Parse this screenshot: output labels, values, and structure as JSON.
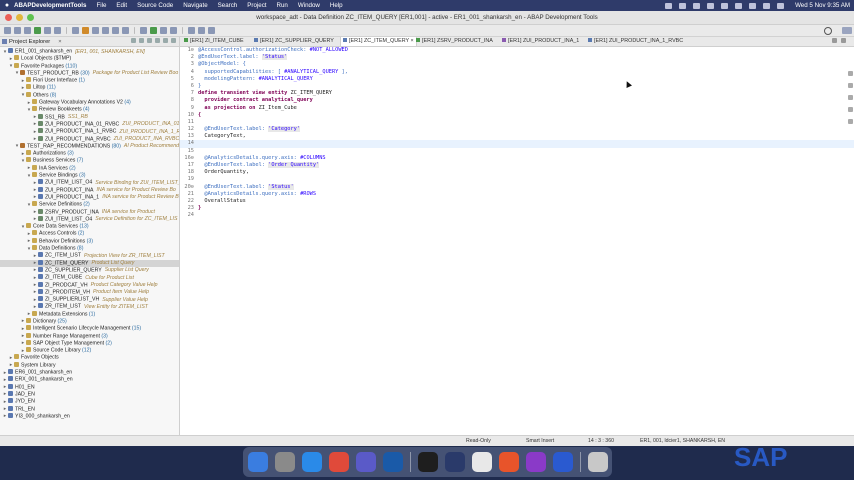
{
  "menubar": {
    "app": "ABAPDevelopmentTools",
    "items": [
      "File",
      "Edit",
      "Source Code",
      "Navigate",
      "Search",
      "Project",
      "Run",
      "Window",
      "Help"
    ],
    "clock": "Wed 5 Nov  9:35 AM"
  },
  "window": {
    "title": "workspace_adt - Data Definition ZC_ITEM_QUERY [ER1,001] - active - ER1_001_shankarsh_en - ABAP Development Tools"
  },
  "explorer": {
    "tab_label": "Project Explorer",
    "tree": [
      {
        "d": 0,
        "a": "▾",
        "label": "ER1_001_shankarsh_en",
        "desc": "[ER1, 001, SHANKARSH, EN]",
        "icon": "project-icon",
        "color": "#5a78b0"
      },
      {
        "d": 1,
        "a": "▸",
        "label": "Local Objects ($TMP)",
        "icon": "folder-icon",
        "color": "#c8a850"
      },
      {
        "d": 1,
        "a": "▾",
        "label": "Favorite Packages",
        "cnt": "(110)",
        "icon": "folder-icon",
        "color": "#c8a850"
      },
      {
        "d": 2,
        "a": "▾",
        "label": "TEST_PRODUCT_RB",
        "cnt": "(30)",
        "desc": "Package for Product List Review Boo",
        "icon": "package-icon",
        "color": "#b07030"
      },
      {
        "d": 3,
        "a": "▸",
        "label": "Fiori User Interface",
        "cnt": "(1)",
        "icon": "folder-icon",
        "color": "#c8a850"
      },
      {
        "d": 3,
        "a": "▸",
        "label": "Liltop",
        "cnt": "(11)",
        "icon": "folder-icon",
        "color": "#c8a850"
      },
      {
        "d": 3,
        "a": "▾",
        "label": "Others",
        "cnt": "(8)",
        "icon": "folder-icon",
        "color": "#c8a850"
      },
      {
        "d": 4,
        "a": "▸",
        "label": "Gateway Vocabulary Annotations V2",
        "cnt": "(4)",
        "icon": "folder-icon",
        "color": "#c8a850"
      },
      {
        "d": 4,
        "a": "▾",
        "label": "Review Bookkeets",
        "cnt": "(4)",
        "icon": "folder-icon",
        "color": "#c8a850"
      },
      {
        "d": 5,
        "a": "▸",
        "label": "SS1_RB",
        "desc": "SS1_RB",
        "icon": "object-icon",
        "color": "#6a8a6a"
      },
      {
        "d": 5,
        "a": "▸",
        "label": "ZUI_PRODUCT_INA_01_RVBC",
        "desc": "ZUI_PRODUCT_INA_01_R",
        "icon": "object-icon",
        "color": "#6a8a6a"
      },
      {
        "d": 5,
        "a": "▸",
        "label": "ZUI_PRODUCT_INA_1_RVBC",
        "desc": "ZUI_PRODUCT_INA_1_RVB",
        "icon": "object-icon",
        "color": "#6a8a6a"
      },
      {
        "d": 5,
        "a": "▸",
        "label": "ZUI_PRODUCT_INA_RVBC",
        "desc": "ZUI_PRODUCT_INA_RVBC",
        "icon": "object-icon",
        "color": "#6a8a6a"
      },
      {
        "d": 2,
        "a": "▾",
        "label": "TEST_RAP_RECOMMENDATIONS",
        "cnt": "(80)",
        "desc": "AI Product Recommend",
        "icon": "package-icon",
        "color": "#b07030"
      },
      {
        "d": 3,
        "a": "▸",
        "label": "Authorizations",
        "cnt": "(3)",
        "icon": "folder-icon",
        "color": "#c8a850"
      },
      {
        "d": 3,
        "a": "▾",
        "label": "Business Services",
        "cnt": "(7)",
        "icon": "folder-icon",
        "color": "#c8a850"
      },
      {
        "d": 4,
        "a": "▸",
        "label": "InA Services",
        "cnt": "(2)",
        "icon": "folder-icon",
        "color": "#c8a850"
      },
      {
        "d": 4,
        "a": "▾",
        "label": "Service Bindings",
        "cnt": "(3)",
        "icon": "folder-icon",
        "color": "#c8a850"
      },
      {
        "d": 5,
        "a": "▸",
        "label": "ZUI_ITEM_LIST_O4",
        "desc": "Service Binding for ZUI_ITEM_LIST_",
        "icon": "binding-icon",
        "color": "#5a78b0"
      },
      {
        "d": 5,
        "a": "▸",
        "label": "ZUI_PRODUCT_INA",
        "desc": "INA service for Product Review Bo",
        "icon": "binding-icon",
        "color": "#5a78b0"
      },
      {
        "d": 5,
        "a": "▸",
        "label": "ZUI_PRODUCT_INA_1",
        "desc": "INA service for Product Review B",
        "icon": "binding-icon",
        "color": "#5a78b0"
      },
      {
        "d": 4,
        "a": "▾",
        "label": "Service Definitions",
        "cnt": "(2)",
        "icon": "folder-icon",
        "color": "#c8a850"
      },
      {
        "d": 5,
        "a": "▸",
        "label": "ZSRV_PRODUCT_INA",
        "desc": "INA service for Product",
        "icon": "service-icon",
        "color": "#6a8a6a"
      },
      {
        "d": 5,
        "a": "▸",
        "label": "ZUI_ITEM_LIST_O4",
        "desc": "Service Definition for ZC_ITEM_LIS",
        "icon": "service-icon",
        "color": "#6a8a6a"
      },
      {
        "d": 3,
        "a": "▾",
        "label": "Core Data Services",
        "cnt": "(13)",
        "icon": "folder-icon",
        "color": "#c8a850"
      },
      {
        "d": 4,
        "a": "▸",
        "label": "Access Controls",
        "cnt": "(2)",
        "icon": "folder-icon",
        "color": "#c8a850"
      },
      {
        "d": 4,
        "a": "▸",
        "label": "Behavior Definitions",
        "cnt": "(3)",
        "icon": "folder-icon",
        "color": "#c8a850"
      },
      {
        "d": 4,
        "a": "▾",
        "label": "Data Definitions",
        "cnt": "(8)",
        "icon": "folder-icon",
        "color": "#c8a850"
      },
      {
        "d": 5,
        "a": "▸",
        "label": "ZC_ITEM_LIST",
        "desc": "Projection View for ZR_ITEM_LIST",
        "icon": "ddl-icon",
        "color": "#5a78b0"
      },
      {
        "d": 5,
        "a": "▸",
        "label": "ZC_ITEM_QUERY",
        "desc": "Product List Query",
        "icon": "ddl-icon",
        "color": "#5a78b0",
        "sel": true
      },
      {
        "d": 5,
        "a": "▸",
        "label": "ZC_SUPPLIER_QUERY",
        "desc": "Supplier List Query",
        "icon": "ddl-icon",
        "color": "#5a78b0"
      },
      {
        "d": 5,
        "a": "▸",
        "label": "ZI_ITEM_CUBE",
        "desc": "Cube for Product List",
        "icon": "ddl-icon",
        "color": "#5a78b0"
      },
      {
        "d": 5,
        "a": "▸",
        "label": "ZI_PRODCAT_VH",
        "desc": "Product Category Value Help",
        "icon": "ddl-icon",
        "color": "#5a78b0"
      },
      {
        "d": 5,
        "a": "▸",
        "label": "ZI_PRODITEM_VH",
        "desc": "Product Item Value Help",
        "icon": "ddl-icon",
        "color": "#5a78b0"
      },
      {
        "d": 5,
        "a": "▸",
        "label": "ZI_SUPPLIERLIST_VH",
        "desc": "Supplier Value Help",
        "icon": "ddl-icon",
        "color": "#5a78b0"
      },
      {
        "d": 5,
        "a": "▸",
        "label": "ZR_ITEM_LIST",
        "desc": "View Entity for ZITEM_LIST",
        "icon": "ddl-icon",
        "color": "#5a78b0"
      },
      {
        "d": 4,
        "a": "▸",
        "label": "Metadata Extensions",
        "cnt": "(1)",
        "icon": "folder-icon",
        "color": "#c8a850"
      },
      {
        "d": 3,
        "a": "▸",
        "label": "Dictionary",
        "cnt": "(25)",
        "icon": "folder-icon",
        "color": "#c8a850"
      },
      {
        "d": 3,
        "a": "▸",
        "label": "Intelligent Scenario Lifecycle Management",
        "cnt": "(15)",
        "icon": "folder-icon",
        "color": "#c8a850"
      },
      {
        "d": 3,
        "a": "▸",
        "label": "Number Range Management",
        "cnt": "(3)",
        "icon": "folder-icon",
        "color": "#c8a850"
      },
      {
        "d": 3,
        "a": "▸",
        "label": "SAP Object Type Management",
        "cnt": "(2)",
        "icon": "folder-icon",
        "color": "#c8a850"
      },
      {
        "d": 3,
        "a": "▸",
        "label": "Source Code Library",
        "cnt": "(12)",
        "icon": "folder-icon",
        "color": "#c8a850"
      },
      {
        "d": 1,
        "a": "▸",
        "label": "Favorite Objects",
        "icon": "folder-icon",
        "color": "#c8a850"
      },
      {
        "d": 1,
        "a": "▸",
        "label": "System Library",
        "icon": "folder-icon",
        "color": "#c8a850"
      },
      {
        "d": 0,
        "a": "▸",
        "label": "ER6_001_shankarsh_en",
        "icon": "project-icon",
        "color": "#5a78b0"
      },
      {
        "d": 0,
        "a": "▸",
        "label": "ERX_001_shankarsh_en",
        "icon": "project-icon",
        "color": "#5a78b0"
      },
      {
        "d": 0,
        "a": "▸",
        "label": "H01_EN",
        "icon": "project-icon",
        "color": "#5a78b0"
      },
      {
        "d": 0,
        "a": "▸",
        "label": "JAD_EN",
        "icon": "project-icon",
        "color": "#5a78b0"
      },
      {
        "d": 0,
        "a": "▸",
        "label": "JYD_EN",
        "icon": "project-icon",
        "color": "#5a78b0"
      },
      {
        "d": 0,
        "a": "▸",
        "label": "TRL_EN",
        "icon": "project-icon",
        "color": "#5a78b0"
      },
      {
        "d": 0,
        "a": "▸",
        "label": "YI3_000_shankarsh_en",
        "icon": "project-icon",
        "color": "#5a78b0"
      }
    ]
  },
  "editor": {
    "tabs": [
      {
        "label": "[ER1] ZI_ITEM_CUBE",
        "icon": "g"
      },
      {
        "label": "[ER1] ZC_SUPPLIER_QUERY",
        "icon": "b"
      },
      {
        "label": "[ER1] ZC_ITEM_QUERY",
        "icon": "b",
        "active": true
      },
      {
        "label": "[ER1] ZSRV_PRODUCT_INA",
        "icon": "g"
      },
      {
        "label": "[ER1] ZUI_PRODUCT_INA_1",
        "icon": "p"
      },
      {
        "label": "[ER1] ZUI_PRODUCT_INA_1_RVBC",
        "icon": "b"
      }
    ],
    "lines": [
      {
        "n": "1⊖",
        "t": [
          [
            "anno",
            "@AccessControl.authorizationCheck: "
          ],
          [
            "enum",
            "#NOT_ALLOWED"
          ]
        ]
      },
      {
        "n": "2",
        "t": [
          [
            "anno",
            "@EndUserText.label: "
          ],
          [
            "str",
            "'Status'"
          ]
        ]
      },
      {
        "n": "3",
        "t": [
          [
            "anno",
            "@ObjectModel: {"
          ]
        ]
      },
      {
        "n": "4",
        "t": [
          [
            "anno",
            "  supportedCapabilities: [ "
          ],
          [
            "enum",
            "#ANALYTICAL_QUERY"
          ],
          [
            "anno",
            " ],"
          ]
        ]
      },
      {
        "n": "5",
        "t": [
          [
            "anno",
            "  modelingPattern: "
          ],
          [
            "enum",
            "#ANALYTICAL_QUERY"
          ]
        ]
      },
      {
        "n": "6",
        "t": [
          [
            "anno",
            "}"
          ]
        ]
      },
      {
        "n": "7",
        "t": [
          [
            "kw",
            "define transient view entity "
          ],
          [
            "plain",
            "ZC_ITEM_QUERY"
          ]
        ]
      },
      {
        "n": "8",
        "t": [
          [
            "kw",
            "  provider contract analytical_query"
          ]
        ]
      },
      {
        "n": "9",
        "t": [
          [
            "kw",
            "  as projection on "
          ],
          [
            "plain",
            "ZI_Item_Cube"
          ]
        ]
      },
      {
        "n": "10",
        "t": [
          [
            "kw",
            "{"
          ]
        ]
      },
      {
        "n": "11",
        "t": []
      },
      {
        "n": "12",
        "t": [
          [
            "anno",
            "  @EndUserText.label: "
          ],
          [
            "str",
            "'Category'"
          ]
        ]
      },
      {
        "n": "13",
        "t": [
          [
            "plain",
            "  CategoryText,"
          ]
        ]
      },
      {
        "n": "14",
        "t": [],
        "cur": true
      },
      {
        "n": "15",
        "t": []
      },
      {
        "n": "16⊖",
        "t": [
          [
            "anno",
            "  @AnalyticsDetails.query.axis: "
          ],
          [
            "enum",
            "#COLUMNS"
          ]
        ]
      },
      {
        "n": "17",
        "t": [
          [
            "anno",
            "  @EndUserText.label: "
          ],
          [
            "str",
            "'Order Quantity'"
          ]
        ]
      },
      {
        "n": "18",
        "t": [
          [
            "plain",
            "  OrderQuantity,"
          ]
        ]
      },
      {
        "n": "19",
        "t": []
      },
      {
        "n": "20⊖",
        "t": [
          [
            "anno",
            "  @EndUserText.label: "
          ],
          [
            "str",
            "'Status'"
          ]
        ]
      },
      {
        "n": "21",
        "t": [
          [
            "anno",
            "  @AnalyticsDetails.query.axis: "
          ],
          [
            "enum",
            "#ROWS"
          ]
        ]
      },
      {
        "n": "22",
        "t": [
          [
            "plain",
            "  OverallStatus"
          ]
        ]
      },
      {
        "n": "23",
        "t": [
          [
            "kw",
            "}"
          ]
        ]
      },
      {
        "n": "24",
        "t": []
      }
    ]
  },
  "status": {
    "mode": "Read-Only",
    "insert": "Smart Insert",
    "position": "14 : 3 : 360",
    "system": "ER1, 001, ldcier1, SHANKARSH, EN"
  },
  "colors": {
    "menubar": "#2f3b6a",
    "selection": "#d4d4d4",
    "current_line": "#e8f2fe",
    "keyword": "#7f0055",
    "annotation": "#3b6dbf",
    "string": "#2a00ff"
  },
  "dock": {
    "apps": [
      {
        "name": "finder-icon",
        "color": "#3a7de0"
      },
      {
        "name": "system-settings-icon",
        "color": "#8a8a8a"
      },
      {
        "name": "appstore-icon",
        "color": "#2a8ae8"
      },
      {
        "name": "chrome-icon",
        "color": "#e04a3a"
      },
      {
        "name": "teams-icon",
        "color": "#5a5ac8"
      },
      {
        "name": "sap-logon-icon",
        "color": "#1a5aa8"
      },
      {
        "name": "terminal-icon",
        "color": "#1e1e1e"
      },
      {
        "name": "eclipse-adt-icon",
        "color": "#2a3a6a"
      },
      {
        "name": "sap-gui-icon",
        "color": "#e8e8e8"
      },
      {
        "name": "brave-icon",
        "color": "#e8542a"
      },
      {
        "name": "onenote-icon",
        "color": "#8a3ac8"
      },
      {
        "name": "vpn-icon",
        "color": "#2a5ad0"
      },
      {
        "name": "trash-icon",
        "color": "#c8c8c8"
      }
    ]
  },
  "wallpaper_text": "SAP"
}
